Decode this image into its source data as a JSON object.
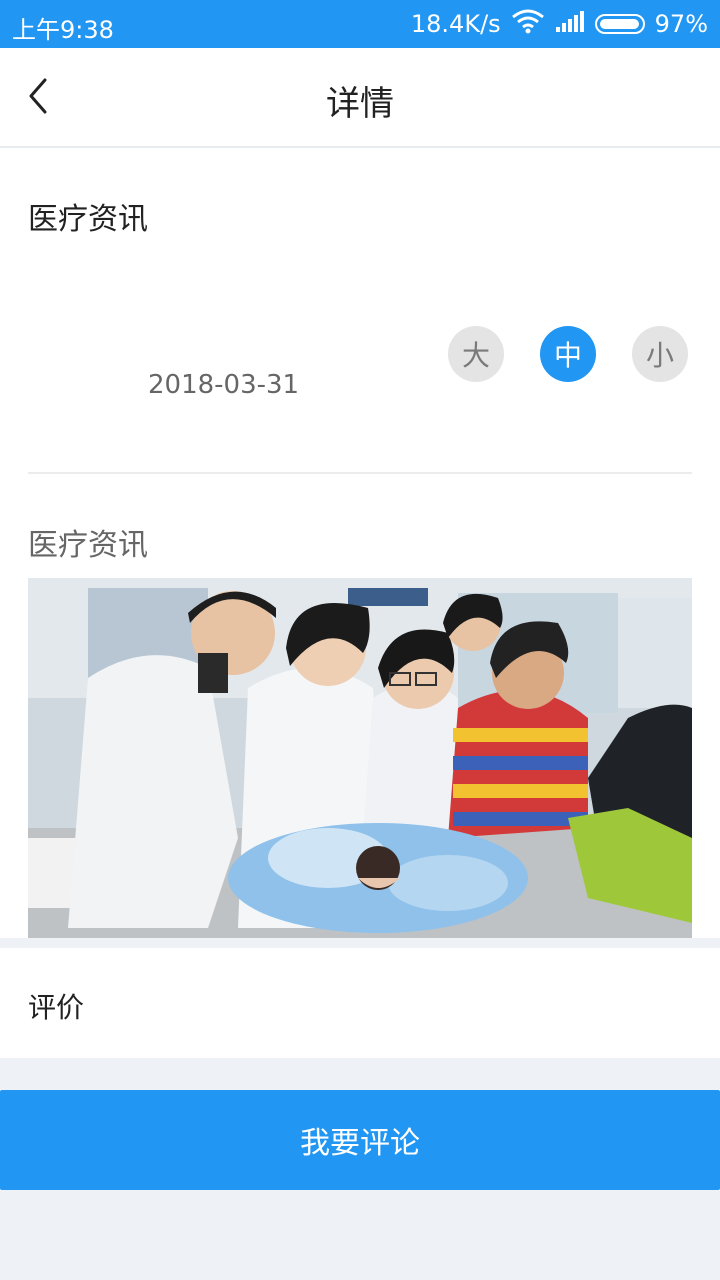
{
  "status_bar": {
    "time": "上午9:38",
    "speed": "18.4K/s",
    "battery": "97%",
    "icons": [
      "wifi-icon",
      "signal-icon",
      "battery-icon"
    ]
  },
  "header": {
    "title": "详情",
    "back_icon": "chevron-left-icon"
  },
  "article": {
    "title": "医疗资讯",
    "date": "2018-03-31",
    "subtitle": "医疗资讯",
    "font_sizes": {
      "large": "大",
      "medium": "中",
      "small": "小",
      "selected": "medium"
    }
  },
  "review": {
    "label": "评价"
  },
  "actions": {
    "comment_button": "我要评论"
  },
  "colors": {
    "accent": "#2196f3",
    "background": "#eef2f6",
    "inactive_button": "#e4e4e4"
  }
}
